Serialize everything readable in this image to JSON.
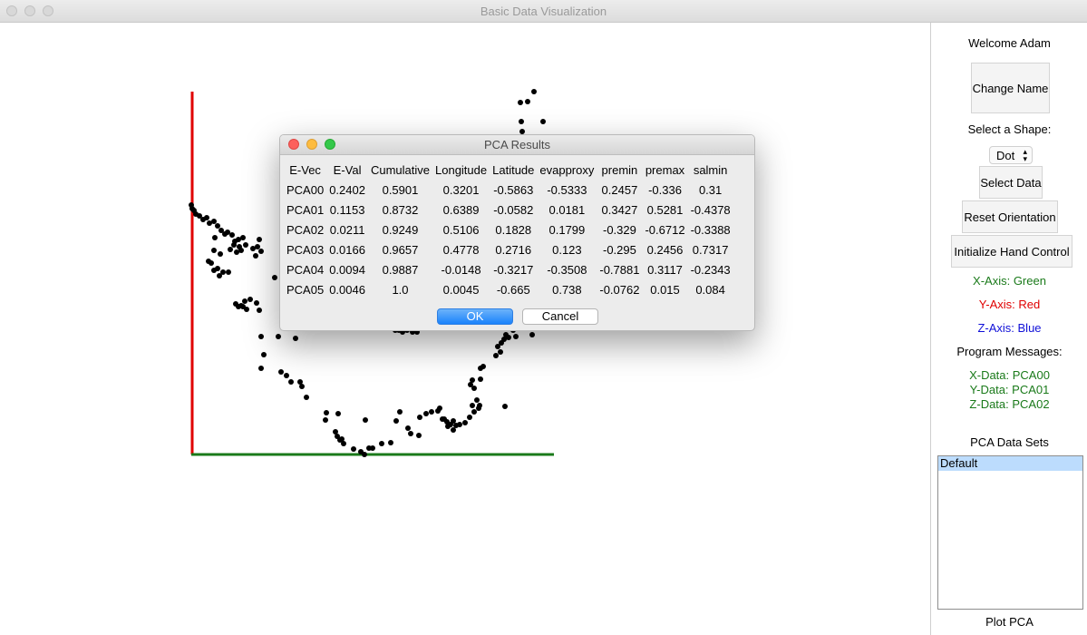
{
  "window": {
    "title": "Basic Data Visualization"
  },
  "sidebar": {
    "welcome": "Welcome Adam",
    "change_name_label": "Change Name",
    "select_shape_label": "Select a Shape:",
    "shape_value": "Dot",
    "select_data_label": "Select Data",
    "reset_orientation_label": "Reset Orientation",
    "init_hand_label": "Initialize Hand Control",
    "x_axis_label": "X-Axis: Green",
    "y_axis_label": "Y-Axis: Red",
    "z_axis_label": "Z-Axis: Blue",
    "program_messages_label": "Program Messages:",
    "messages": [
      "X-Data: PCA00",
      "Y-Data: PCA01",
      "Z-Data: PCA02"
    ],
    "pca_sets_label": "PCA Data Sets",
    "pca_sets": [
      "Default"
    ],
    "plot_pca_label": "Plot PCA"
  },
  "dialog": {
    "title": "PCA Results",
    "columns": [
      "E-Vec",
      "E-Val",
      "Cumulative",
      "Longitude",
      "Latitude",
      "evapproxy",
      "premin",
      "premax",
      "salmin"
    ],
    "rows": [
      [
        "PCA00",
        "0.2402",
        "0.5901",
        "0.3201",
        "-0.5863",
        "-0.5333",
        "0.2457",
        "-0.336",
        "0.31"
      ],
      [
        "PCA01",
        "0.1153",
        "0.8732",
        "0.6389",
        "-0.0582",
        "0.0181",
        "0.3427",
        "0.5281",
        "-0.4378"
      ],
      [
        "PCA02",
        "0.0211",
        "0.9249",
        "0.5106",
        "0.1828",
        "0.1799",
        "-0.329",
        "-0.6712",
        "-0.3388"
      ],
      [
        "PCA03",
        "0.0166",
        "0.9657",
        "0.4778",
        "0.2716",
        "0.123",
        "-0.295",
        "0.2456",
        "0.7317"
      ],
      [
        "PCA04",
        "0.0094",
        "0.9887",
        "-0.0148",
        "-0.3217",
        "-0.3508",
        "-0.7881",
        "0.3117",
        "-0.2343"
      ],
      [
        "PCA05",
        "0.0046",
        "1.0",
        "0.0045",
        "-0.665",
        "0.738",
        "-0.0762",
        "0.015",
        "0.084"
      ]
    ],
    "ok_label": "OK",
    "cancel_label": "Cancel"
  },
  "colors": {
    "x_axis": "#1a7a1a",
    "y_axis": "#e00000",
    "z_axis": "#1010d8",
    "points": "#000000",
    "ok_button": "#1a82fb"
  }
}
